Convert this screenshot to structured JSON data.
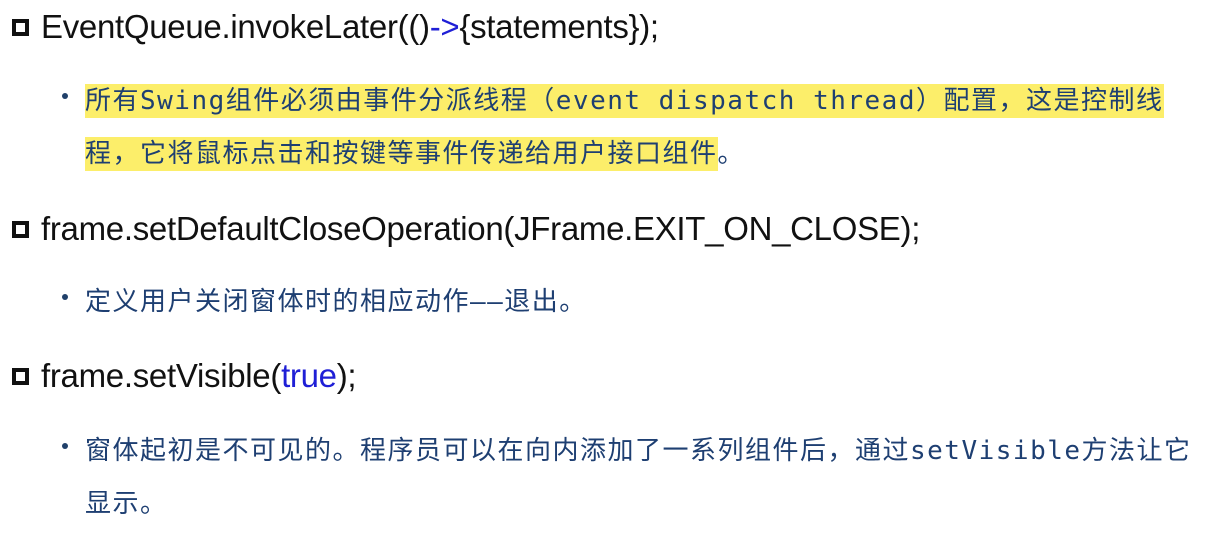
{
  "headings": [
    {
      "prefix": "EventQueue.invokeLater(()",
      "arrow": "->",
      "suffix": "{statements});"
    },
    {
      "text": "frame.setDefaultCloseOperation(JFrame.EXIT_ON_CLOSE);"
    },
    {
      "prefix": "frame.setVisible(",
      "keyword": "true",
      "suffix": ");"
    }
  ],
  "bullets": [
    {
      "highlighted": "所有Swing组件必须由事件分派线程（event dispatch thread）配置，这是控制线程，它将鼠标点击和按键等事件传递给用户接口组件",
      "tail": "。"
    },
    {
      "text": "定义用户关闭窗体时的相应动作——退出。"
    },
    {
      "text": "窗体起初是不可见的。程序员可以在向内添加了一系列组件后，通过setVisible方法让它显示。"
    }
  ],
  "colors": {
    "heading_text": "#111111",
    "code_blue": "#1f1fd6",
    "bullet_text": "#1e3f72",
    "highlight": "#fcee6a"
  }
}
